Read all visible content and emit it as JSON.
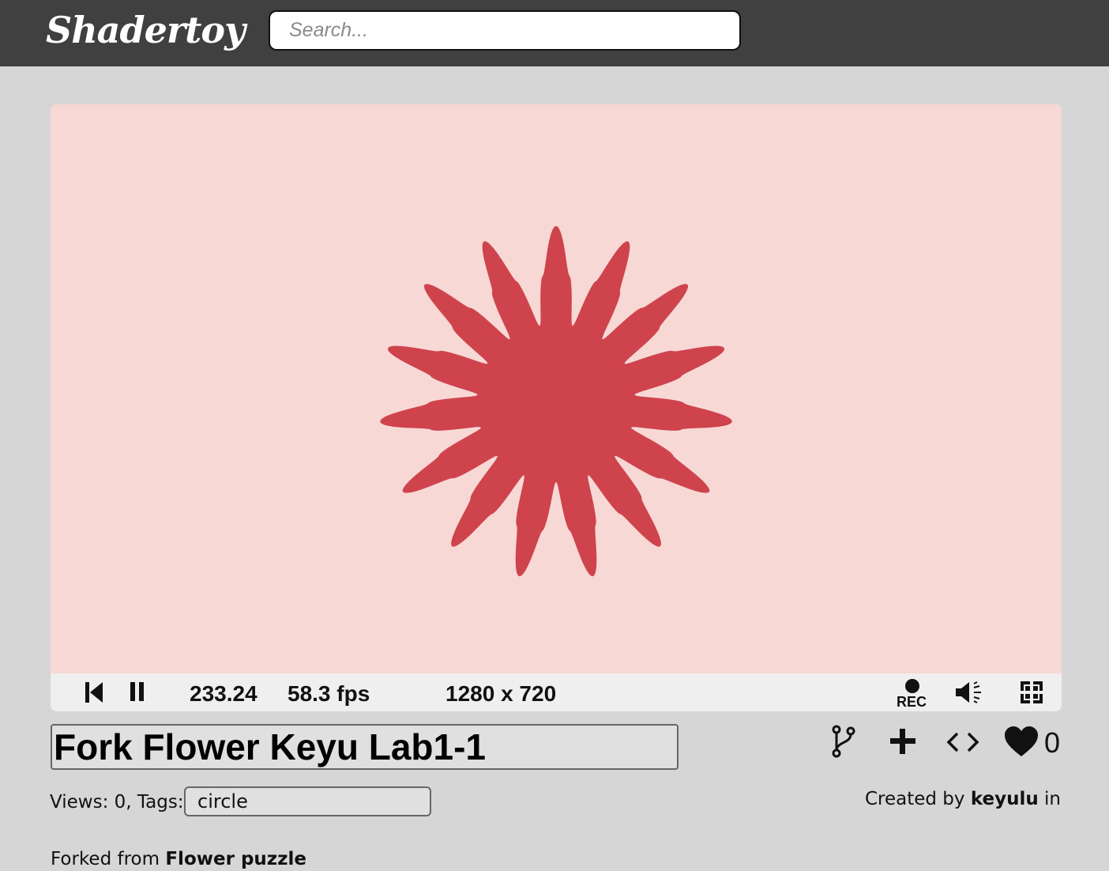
{
  "header": {
    "logo_text": "Shadertoy",
    "search_placeholder": "Search..."
  },
  "player": {
    "time": "233.24",
    "fps": "58.3 fps",
    "resolution": "1280 x 720",
    "rec_label": "REC",
    "canvas_background": "#f7d8d5",
    "flower_color": "#cf434d"
  },
  "shader": {
    "title": "Fork Flower Keyu Lab1-1",
    "views_label": "Views: 0, Tags:",
    "tag": "circle",
    "created_by_prefix": "Created by",
    "author": "keyulu",
    "created_in_suffix": "in",
    "like_count": "0",
    "forked_from_prefix": "Forked from",
    "forked_from_name": "Flower puzzle"
  },
  "icons": {
    "restart": "skip-back-icon",
    "pause": "pause-icon",
    "record": "record-icon",
    "volume": "volume-icon",
    "fullscreen": "fullscreen-icon",
    "fork": "fork-icon",
    "add": "plus-icon",
    "embed": "code-icon",
    "like": "heart-icon"
  }
}
